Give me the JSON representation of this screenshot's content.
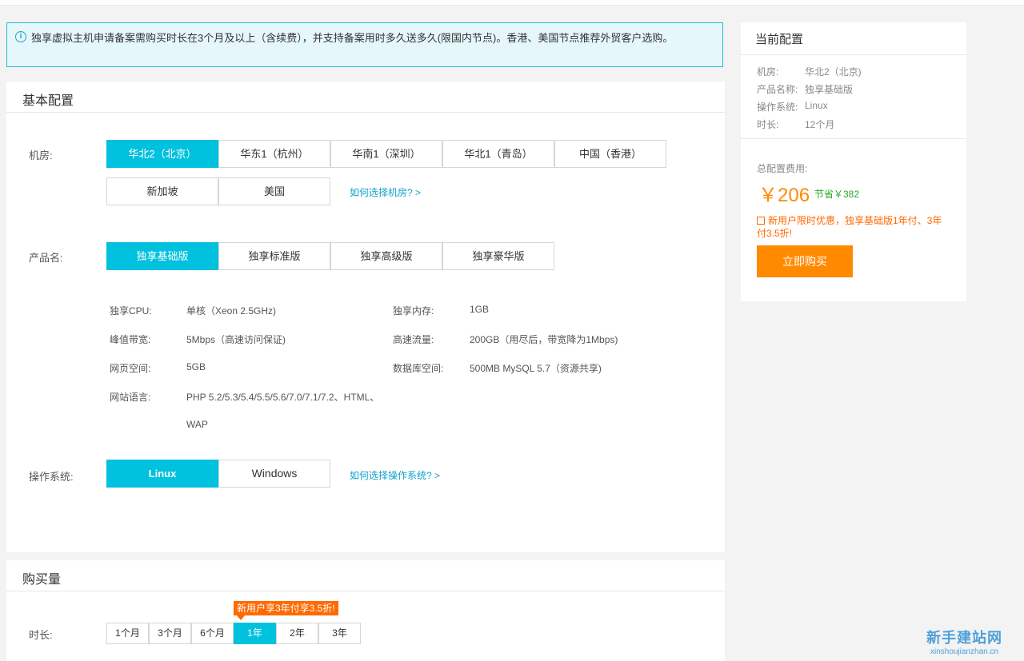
{
  "notice": {
    "icon": "info-icon",
    "text": "独享虚拟主机申请备案需购买时长在3个月及以上（含续费），并支持备案用时多久送多久(限国内节点)。香港、美国节点推荐外贸客户选购。"
  },
  "basic": {
    "title": "基本配置",
    "room_label": "机房:",
    "rooms": [
      "华北2（北京）",
      "华东1（杭州）",
      "华南1（深圳）",
      "华北1（青岛）",
      "中国（香港）",
      "新加坡",
      "美国"
    ],
    "room_selected": "华北2（北京）",
    "room_help": "如何选择机房? >",
    "product_label": "产品名:",
    "products": [
      "独享基础版",
      "独享标准版",
      "独享高级版",
      "独享豪华版"
    ],
    "product_selected": "独享基础版",
    "specs": {
      "cpu_k": "独享CPU:",
      "cpu_v": "单核（Xeon 2.5GHz)",
      "mem_k": "独享内存:",
      "mem_v": "1GB",
      "bw_k": "峰值带宽:",
      "bw_v": "5Mbps（高速访问保证)",
      "flow_k": "高速流量:",
      "flow_v": "200GB（用尽后，带宽降为1Mbps)",
      "web_k": "网页空间:",
      "web_v": "5GB",
      "db_k": "数据库空间:",
      "db_v": "500MB MySQL 5.7（资源共享)",
      "lang_k": "网站语言:",
      "lang_v1": "PHP 5.2/5.3/5.4/5.5/5.6/7.0/7.1/7.2、HTML、",
      "lang_v2": "WAP"
    },
    "os_label": "操作系统:",
    "os_options": [
      "Linux",
      "Windows"
    ],
    "os_selected": "Linux",
    "os_help": "如何选择操作系统? >"
  },
  "purchase": {
    "title": "购买量",
    "duration_label": "时长:",
    "durations": [
      "1个月",
      "3个月",
      "6个月",
      "1年",
      "2年",
      "3年"
    ],
    "duration_selected": "1年",
    "tip": "新用户享3年付享3.5折!"
  },
  "summary": {
    "title": "当前配置",
    "rows": [
      {
        "k": "机房:",
        "v": "华北2（北京)"
      },
      {
        "k": "产品名称:",
        "v": "独享基础版"
      },
      {
        "k": "操作系统:",
        "v": "Linux"
      },
      {
        "k": "时长:",
        "v": "12个月"
      }
    ],
    "total_label": "总配置费用:",
    "price": "￥206",
    "save": "节省￥382",
    "promo": "新用户限时优惠，独享基础版1年付、3年付3.5折!",
    "buy_label": "立即购买"
  },
  "watermark": {
    "main": "新手建站网",
    "sub": "xinshoujianzhan.cn"
  },
  "colors": {
    "accent": "#00c1de",
    "orange": "#ff8a00",
    "green": "#2ca52c"
  }
}
